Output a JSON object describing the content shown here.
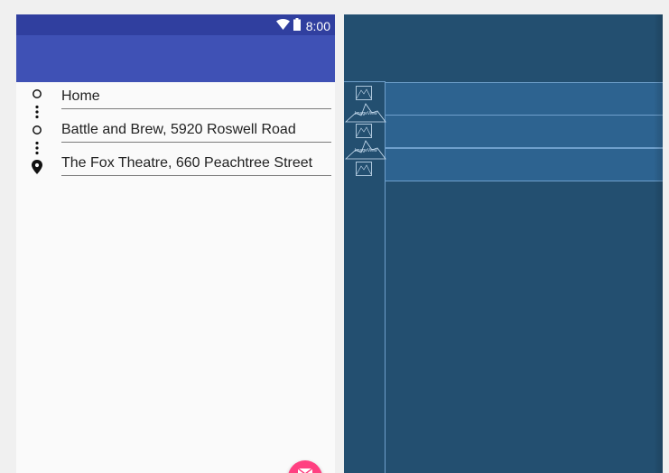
{
  "status_bar": {
    "time": "8:00"
  },
  "directions": [
    {
      "label": "Home",
      "marker": "circle-outline-icon"
    },
    {
      "label": "Battle and Brew, 5920 Roswell Road",
      "marker": "circle-outline-icon"
    },
    {
      "label": "The Fox Theatre, 660 Peachtree Street",
      "marker": "place-icon"
    }
  ],
  "blueprint": {
    "image_view_label": "ImageView"
  },
  "colors": {
    "primary_dark": "#303f9f",
    "primary": "#3f51b5",
    "accent": "#ff4081",
    "blueprint_bg": "#234f70",
    "blueprint_line": "#6fa0cc"
  }
}
